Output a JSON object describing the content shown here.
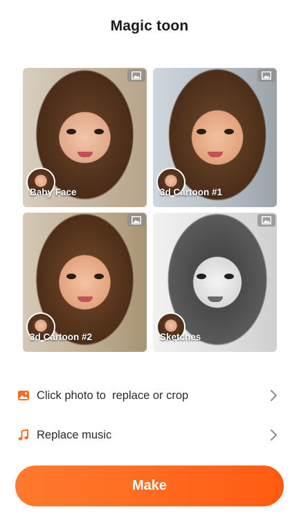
{
  "header": {
    "title": "Magic toon"
  },
  "styles": [
    {
      "label": "Baby Face",
      "icon": "image-icon"
    },
    {
      "label": "3d Cartoon #1",
      "icon": "image-icon"
    },
    {
      "label": "3d Cartoon #2",
      "icon": "image-icon"
    },
    {
      "label": "Sketches",
      "icon": "image-icon"
    }
  ],
  "options": [
    {
      "label": "Click photo to  replace or crop",
      "icon": "photo-icon"
    },
    {
      "label": "Replace music",
      "icon": "music-note-icon"
    }
  ],
  "actions": {
    "make_label": "Make"
  },
  "colors": {
    "accent": "#ff6a1f",
    "accent_light": "#ff7a2e"
  }
}
